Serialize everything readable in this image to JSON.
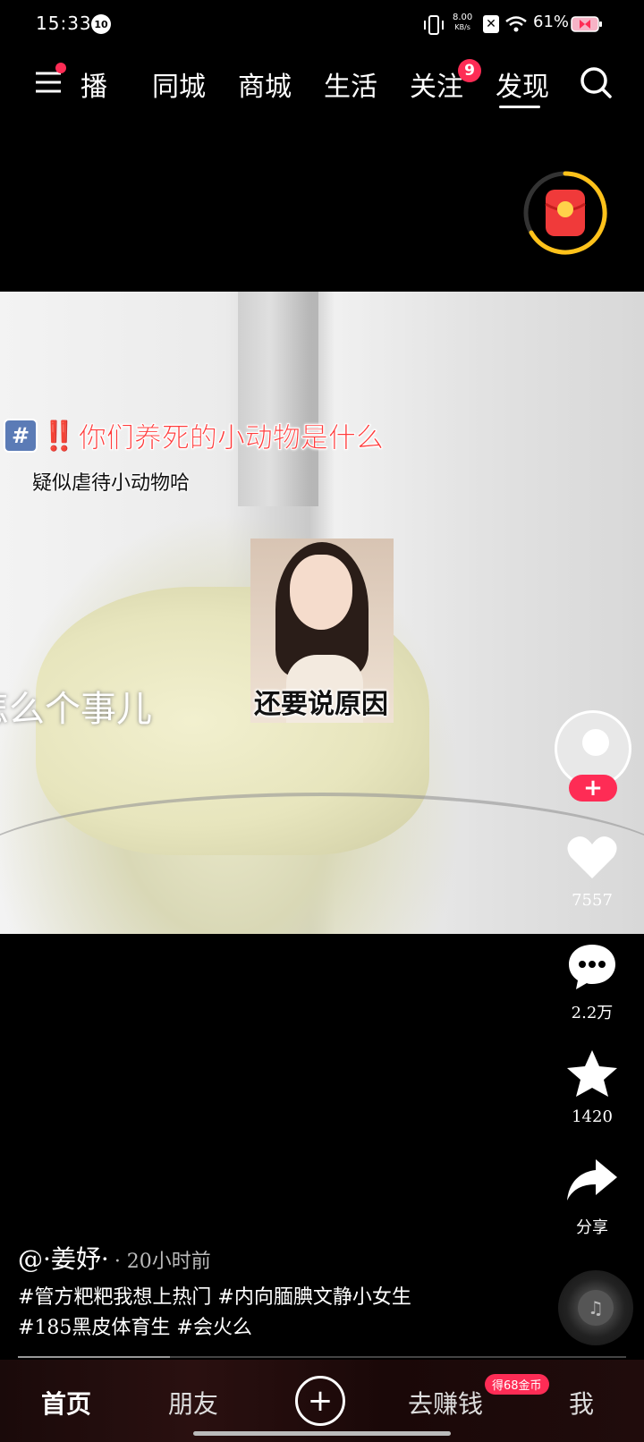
{
  "status_bar": {
    "time": "15:33",
    "notification_badge": "10",
    "net_speed_value": "8.00",
    "net_speed_unit": "KB/s",
    "battery": "61%"
  },
  "top_nav": {
    "tabs": [
      "播",
      "同城",
      "商城",
      "生活",
      "关注",
      "发现"
    ],
    "active_tab": "发现",
    "follow_badge": "9"
  },
  "video": {
    "hashtag_icon": "#",
    "hashtag_bang": "‼️",
    "hashtag_text": "你们养死的小动物是什么",
    "sub_caption": "疑似虐待小动物哈",
    "side_caption": "怎么个事儿",
    "sticker_caption": "还要说原因"
  },
  "actions": {
    "follow_plus": "+",
    "likes": "7557",
    "comments": "2.2万",
    "favorites": "1420",
    "share": "分享"
  },
  "post": {
    "author": "@·姜妤·",
    "time": "· 20小时前",
    "description": "#管方粑粑我想上热门 #内向腼腆文静小女生 #185黑皮体育生 #会火么",
    "progress": 0.25
  },
  "bottom_tabs": {
    "home": "首页",
    "friends": "朋友",
    "add": "+",
    "earn": "去赚钱",
    "earn_badge": "得68金币",
    "me": "我"
  },
  "colors": {
    "accent": "#fe2c55",
    "background": "#000000"
  }
}
